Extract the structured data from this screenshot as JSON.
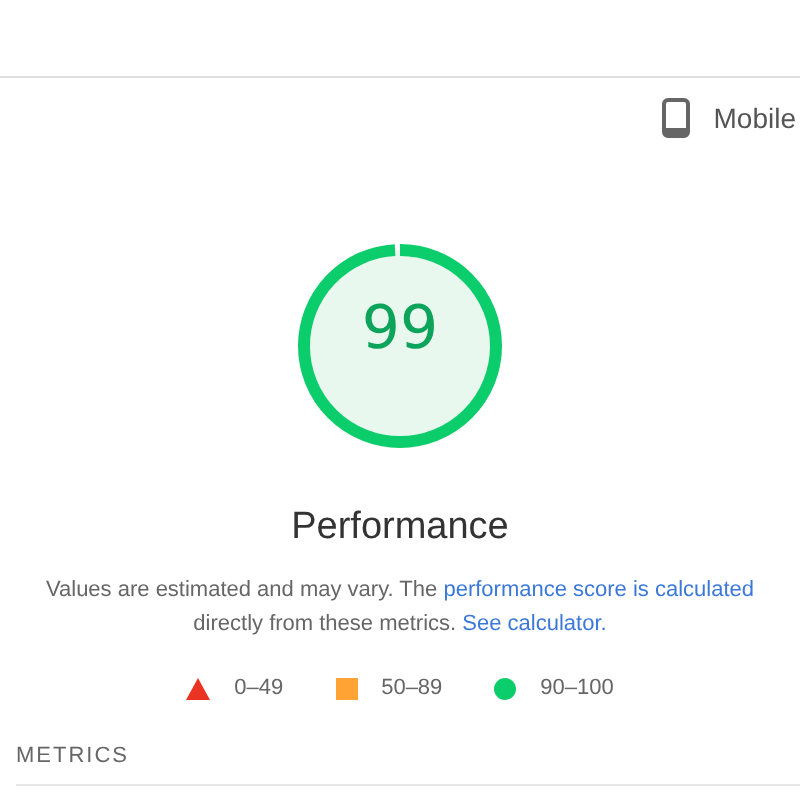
{
  "device": {
    "label": "Mobile"
  },
  "gauge": {
    "score": "99",
    "level": 0.99,
    "title": "Performance"
  },
  "description": {
    "text": "Values are estimated and may vary. The",
    "link": "performance score is calculated",
    "text2": "directly from these metrics.",
    "link2": "See calculator."
  },
  "legend": [
    {
      "kind": "triangle",
      "label": "0–49",
      "color": "#eb3323"
    },
    {
      "kind": "square",
      "label": "50–89",
      "color": "#ffa334"
    },
    {
      "kind": "circle",
      "label": "90–100",
      "color": "#0ccd6b"
    }
  ],
  "section": {
    "title": "METRICS"
  }
}
